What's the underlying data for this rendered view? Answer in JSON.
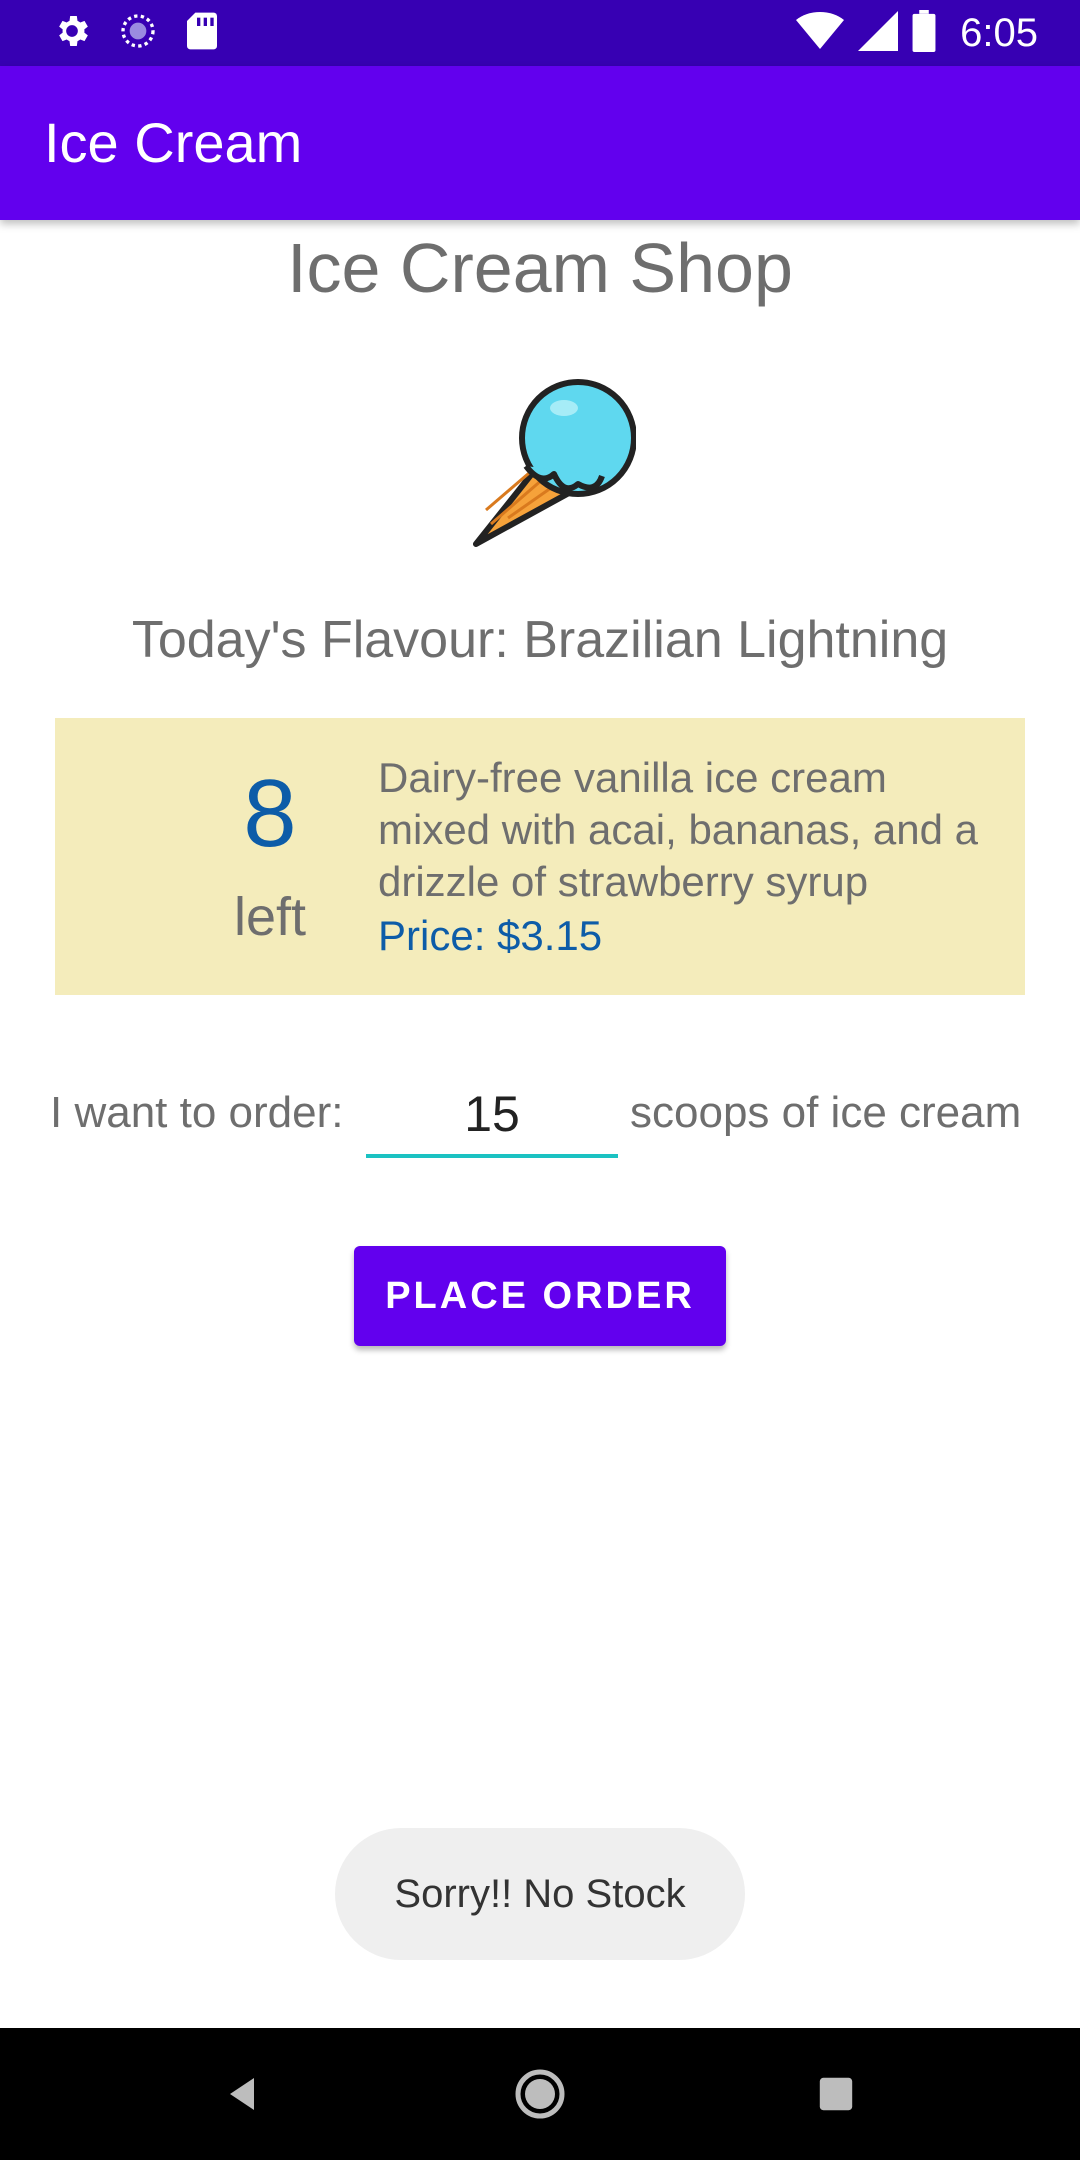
{
  "status_bar": {
    "time": "6:05",
    "icons": [
      "gear-icon",
      "sync-icon",
      "sd-card-icon",
      "wifi-icon",
      "signal-icon",
      "battery-icon"
    ]
  },
  "app_bar": {
    "title": "Ice Cream"
  },
  "shop": {
    "title": "Ice Cream Shop",
    "image_icon": "ice-cream-cone-icon",
    "flavour_line": "Today's Flavour: Brazilian Lightning"
  },
  "card": {
    "stock_count": "8",
    "stock_label": "left",
    "description": "Dairy-free vanilla ice cream mixed with acai, bananas, and a drizzle of strawberry syrup",
    "price": "Price: $3.15"
  },
  "order": {
    "prefix": "I want to order:",
    "quantity": "15",
    "suffix": "scoops of ice cream",
    "button_label": "PLACE ORDER"
  },
  "toast": {
    "message": "Sorry!! No Stock"
  },
  "nav": {
    "icons": [
      "back-icon",
      "home-icon",
      "recents-icon"
    ]
  },
  "colors": {
    "status_bar": "#3700b3",
    "app_bar": "#6200ee",
    "card_bg": "#f4ecbb",
    "accent_blue": "#0d5ca8",
    "input_underline": "#1bc2c2"
  }
}
